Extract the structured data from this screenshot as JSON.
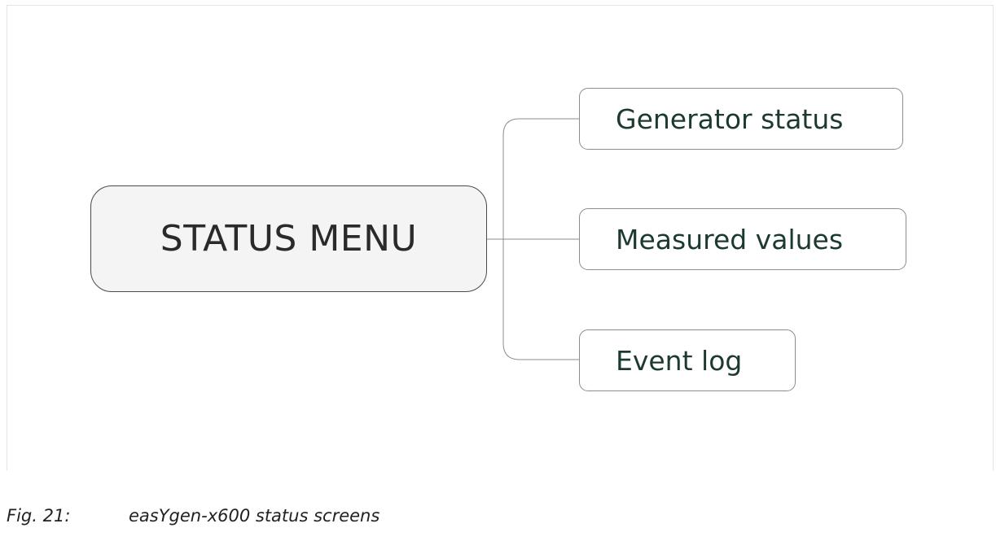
{
  "diagram": {
    "root": {
      "label": "STATUS MENU"
    },
    "children": [
      {
        "label": "Generator status"
      },
      {
        "label": "Measured values"
      },
      {
        "label": "Event log"
      }
    ],
    "colors": {
      "root_fill": "#f4f4f4",
      "root_border": "#4a4a4a",
      "child_border": "#8c8c8c",
      "child_text": "#1d3a2e",
      "connector": "#8c8c8c"
    }
  },
  "caption": {
    "number": "Fig. 21:",
    "text": "easYgen-x600 status screens"
  }
}
